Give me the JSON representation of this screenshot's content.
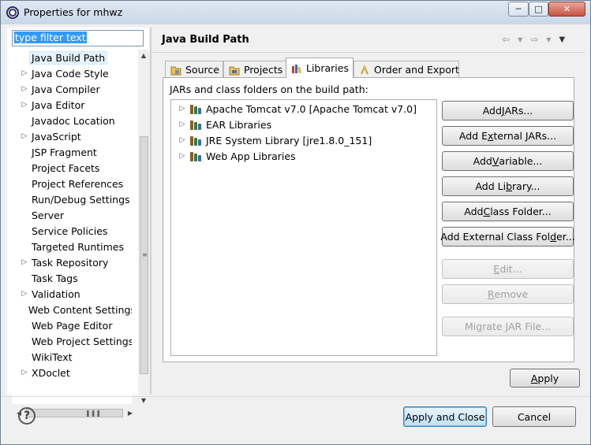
{
  "window": {
    "title": "Properties for mhwz"
  },
  "filter": {
    "placeholder": "type filter text"
  },
  "sidebar": {
    "items": [
      {
        "label": "Java Build Path",
        "expandable": false,
        "selected": true
      },
      {
        "label": "Java Code Style",
        "expandable": true
      },
      {
        "label": "Java Compiler",
        "expandable": true
      },
      {
        "label": "Java Editor",
        "expandable": true
      },
      {
        "label": "Javadoc Location",
        "expandable": false
      },
      {
        "label": "JavaScript",
        "expandable": true
      },
      {
        "label": "JSP Fragment",
        "expandable": false
      },
      {
        "label": "Project Facets",
        "expandable": false
      },
      {
        "label": "Project References",
        "expandable": false
      },
      {
        "label": "Run/Debug Settings",
        "expandable": false
      },
      {
        "label": "Server",
        "expandable": false
      },
      {
        "label": "Service Policies",
        "expandable": false
      },
      {
        "label": "Targeted Runtimes",
        "expandable": false
      },
      {
        "label": "Task Repository",
        "expandable": true
      },
      {
        "label": "Task Tags",
        "expandable": false
      },
      {
        "label": "Validation",
        "expandable": true
      },
      {
        "label": "Web Content Settings",
        "expandable": false
      },
      {
        "label": "Web Page Editor",
        "expandable": false
      },
      {
        "label": "Web Project Settings",
        "expandable": false
      },
      {
        "label": "WikiText",
        "expandable": false
      },
      {
        "label": "XDoclet",
        "expandable": true
      }
    ]
  },
  "page": {
    "title": "Java Build Path"
  },
  "tabs": [
    {
      "label": "Source",
      "icon": "source-folder-icon",
      "active": false
    },
    {
      "label": "Projects",
      "icon": "projects-icon",
      "active": false
    },
    {
      "label": "Libraries",
      "icon": "libraries-icon",
      "active": true
    },
    {
      "label": "Order and Export",
      "icon": "order-export-icon",
      "active": false
    }
  ],
  "libraries": {
    "section_label": "JARs and class folders on the build path:",
    "entries": [
      "Apache Tomcat v7.0 [Apache Tomcat v7.0]",
      "EAR Libraries",
      "JRE System Library [jre1.8.0_151]",
      "Web App Libraries"
    ]
  },
  "buttons": {
    "add_jars": {
      "pre": "Add ",
      "mn": "J",
      "post": "ARs..."
    },
    "add_external_jars": {
      "pre": "Add E",
      "mn": "x",
      "post": "ternal JARs..."
    },
    "add_variable": {
      "pre": "Add ",
      "mn": "V",
      "post": "ariable..."
    },
    "add_library": {
      "pre": "Add Li",
      "mn": "b",
      "post": "rary..."
    },
    "add_class_folder": {
      "pre": "Add ",
      "mn": "C",
      "post": "lass Folder..."
    },
    "add_external_class_folder": {
      "pre": "Add External Class Fol",
      "mn": "d",
      "post": "er..."
    },
    "edit": {
      "pre": "",
      "mn": "E",
      "post": "dit..."
    },
    "remove": {
      "pre": "",
      "mn": "R",
      "post": "emove"
    },
    "migrate_jar": {
      "pre": "Mi",
      "mn": "g",
      "post": "rate JAR File..."
    },
    "apply": {
      "pre": "",
      "mn": "A",
      "post": "pply"
    },
    "apply_and_close": "Apply and Close",
    "cancel": "Cancel"
  }
}
